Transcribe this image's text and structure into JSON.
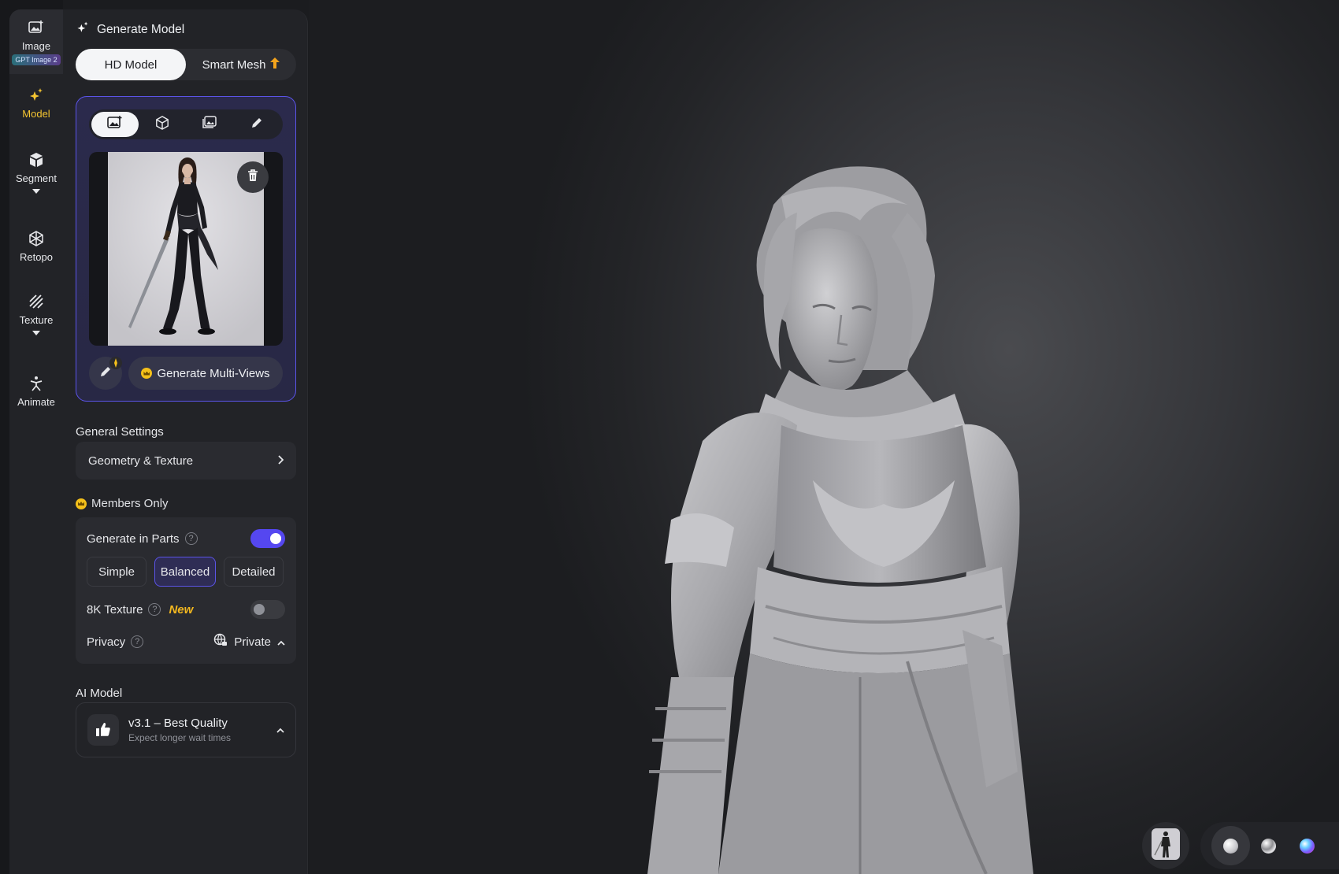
{
  "rail": {
    "items": [
      {
        "label": "Image",
        "badge": "GPT Image 2",
        "icon": "image-icon"
      },
      {
        "label": "Model",
        "icon": "sparkle-icon",
        "active": true
      },
      {
        "label": "Segment",
        "icon": "segment-cube-icon",
        "has_dropdown": true
      },
      {
        "label": "Retopo",
        "icon": "retopo-icon"
      },
      {
        "label": "Texture",
        "icon": "texture-hatch-icon",
        "has_dropdown": true
      },
      {
        "label": "Animate",
        "icon": "animate-figure-icon"
      }
    ]
  },
  "panel": {
    "title": "Generate Model",
    "mode_options": [
      {
        "label": "HD Model",
        "selected": true
      },
      {
        "label": "Smart Mesh",
        "icon": "upgrade-arrow-icon",
        "selected": false
      }
    ],
    "input_tabs": [
      "image-input-icon",
      "cube-input-icon",
      "multi-image-input-icon",
      "pencil-input-icon"
    ],
    "multi_views_label": "Generate Multi-Views",
    "general_settings_label": "General Settings",
    "geometry_label": "Geometry & Texture",
    "members_label": "Members Only",
    "generate_parts_label": "Generate in Parts",
    "generate_parts_on": true,
    "levels": [
      "Simple",
      "Balanced",
      "Detailed"
    ],
    "selected_level": "Balanced",
    "texture_8k_label": "8K Texture",
    "new_tag": "New",
    "texture_8k_on": false,
    "privacy_label": "Privacy",
    "privacy_value": "Private",
    "help_glyph": "?",
    "ai_model_label": "AI Model",
    "ai_model_name": "v3.1 – Best Quality",
    "ai_model_note": "Expect longer wait times"
  },
  "viewport": {
    "material_presets": [
      {
        "name": "clay-white",
        "color": "#e9e9ec",
        "selected": true
      },
      {
        "name": "matcap-chrome",
        "color": "#c9c9cc"
      },
      {
        "name": "normal-rainbow",
        "color": "#7a6cff"
      },
      {
        "name": "settings-sliders",
        "icon": "sliders-icon"
      },
      {
        "name": "gray-matte",
        "color": "#9c9ca0"
      },
      {
        "name": "orange-gloss",
        "color": "#f0a020"
      },
      {
        "name": "silver",
        "color": "#b8b8bc"
      },
      {
        "name": "cyan",
        "color": "#5fdccf"
      }
    ]
  },
  "colors": {
    "accent": "#5b54e8",
    "active_rail": "#f5c531",
    "gold": "#f4c01a"
  }
}
